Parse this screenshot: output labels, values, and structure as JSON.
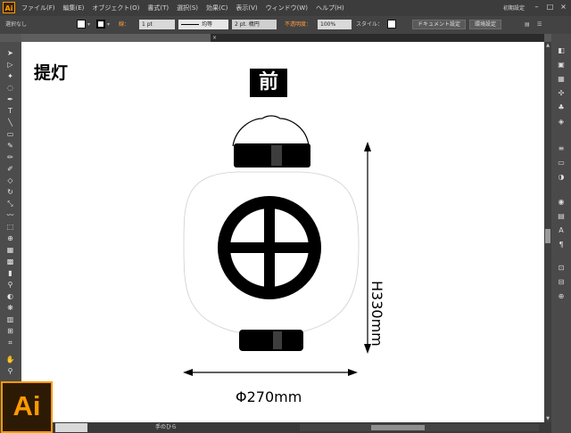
{
  "app": {
    "logo_text": "Ai"
  },
  "menu": {
    "items": [
      "ファイル(F)",
      "編集(E)",
      "オブジェクト(O)",
      "書式(T)",
      "選択(S)",
      "効果(C)",
      "表示(V)",
      "ウィンドウ(W)",
      "ヘルプ(H)"
    ],
    "workspace_label": "初期設定"
  },
  "window_controls": {
    "minimize": "–",
    "maximize": "□",
    "close": "×"
  },
  "control_bar": {
    "selection_label": "選択なし",
    "stroke_label": "線：",
    "stroke_weight": "1 pt",
    "stroke_profile": "均等",
    "brush_definition": "2 pt. 楕円",
    "opacity_label": "不透明度：",
    "opacity_value": "100%",
    "style_label": "スタイル：",
    "document_setup_button": "ドキュメント設定",
    "preferences_button": "環境設定"
  },
  "document_tab": {
    "title": "",
    "close_glyph": "×"
  },
  "artboard": {
    "title": "提灯",
    "front_label": "前",
    "height_dimension": "H330mm",
    "width_dimension": "Φ270mm",
    "colors": {
      "ink": "#000000",
      "paper": "#ffffff",
      "outline": "#c8c8c8"
    }
  },
  "status_bar": {
    "zoom": "",
    "tool_name": "手のひら"
  },
  "icons": {
    "tools": [
      "selection-tool-icon",
      "direct-selection-tool-icon",
      "magic-wand-tool-icon",
      "lasso-tool-icon",
      "pen-tool-icon",
      "type-tool-icon",
      "line-tool-icon",
      "rectangle-tool-icon",
      "paintbrush-tool-icon",
      "pencil-tool-icon",
      "blob-brush-tool-icon",
      "eraser-tool-icon",
      "rotate-tool-icon",
      "scale-tool-icon",
      "warp-tool-icon",
      "free-transform-tool-icon",
      "shape-builder-tool-icon",
      "perspective-grid-tool-icon",
      "mesh-tool-icon",
      "gradient-tool-icon",
      "eyedropper-tool-icon",
      "blend-tool-icon",
      "symbol-sprayer-tool-icon",
      "column-graph-tool-icon",
      "artboard-tool-icon",
      "slice-tool-icon",
      "hand-tool-icon",
      "zoom-tool-icon"
    ]
  }
}
